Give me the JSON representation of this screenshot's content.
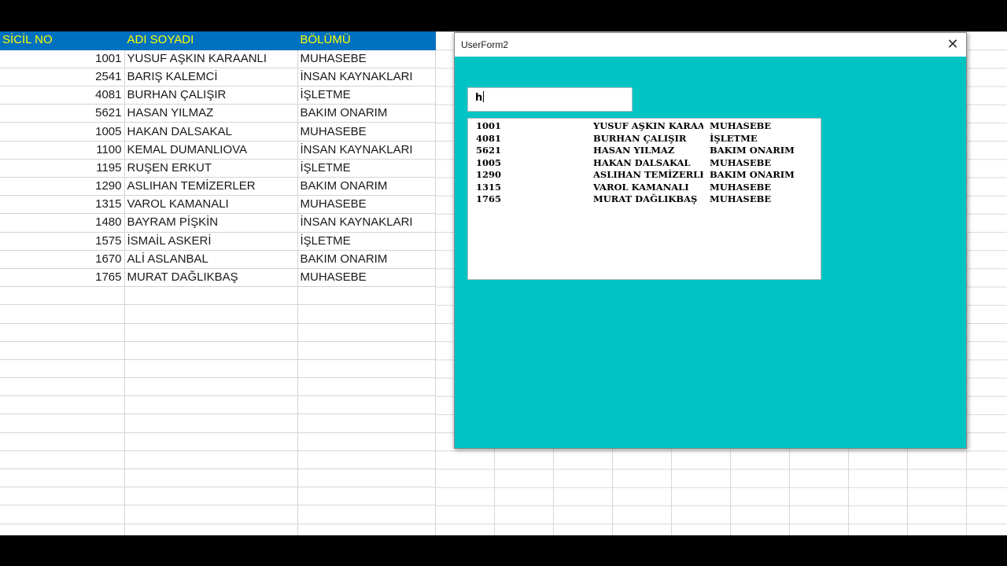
{
  "sheet": {
    "headers": [
      "SİCİL NO",
      "ADI SOYADI",
      "BÖLÜMÜ"
    ],
    "rows": [
      [
        "1001",
        "YUSUF AŞKIN KARAANLI",
        "MUHASEBE"
      ],
      [
        "2541",
        "BARIŞ KALEMCİ",
        "İNSAN KAYNAKLARI"
      ],
      [
        "4081",
        "BURHAN ÇALIŞIR",
        "İŞLETME"
      ],
      [
        "5621",
        "HASAN YILMAZ",
        "BAKIM ONARIM"
      ],
      [
        "1005",
        "HAKAN DALSAKAL",
        "MUHASEBE"
      ],
      [
        "1100",
        "KEMAL DUMANLIOVA",
        "İNSAN KAYNAKLARI"
      ],
      [
        "1195",
        "RUŞEN ERKUT",
        "İŞLETME"
      ],
      [
        "1290",
        "ASLIHAN TEMİZERLER",
        "BAKIM ONARIM"
      ],
      [
        "1315",
        "VAROL KAMANALI",
        "MUHASEBE"
      ],
      [
        "1480",
        "BAYRAM PİŞKİN",
        "İNSAN KAYNAKLARI"
      ],
      [
        "1575",
        "İSMAİL ASKERİ",
        "İŞLETME"
      ],
      [
        "1670",
        "ALİ ASLANBAL",
        "BAKIM ONARIM"
      ],
      [
        "1765",
        "MURAT DAĞLIKBAŞ",
        "MUHASEBE"
      ]
    ],
    "empty_row_count": 14,
    "header_color": "#0070c0",
    "header_text_color": "#ffff00"
  },
  "dialog": {
    "title": "UserForm2",
    "close_icon": "close-icon",
    "close_glyph": "✕",
    "background_color": "#00c4c4",
    "search_value": "h",
    "list_rows": [
      [
        "1001",
        "YUSUF AŞKIN KARAAN",
        "MUHASEBE"
      ],
      [
        "4081",
        "BURHAN ÇALIŞIR",
        "İŞLETME"
      ],
      [
        "5621",
        "HASAN YILMAZ",
        "BAKIM ONARIM"
      ],
      [
        "1005",
        "HAKAN DALSAKAL",
        "MUHASEBE"
      ],
      [
        "1290",
        "ASLIHAN TEMİZERLER",
        "BAKIM ONARIM"
      ],
      [
        "1315",
        "VAROL KAMANALI",
        "MUHASEBE"
      ],
      [
        "1765",
        "MURAT DAĞLIKBAŞ",
        "MUHASEBE"
      ]
    ]
  }
}
